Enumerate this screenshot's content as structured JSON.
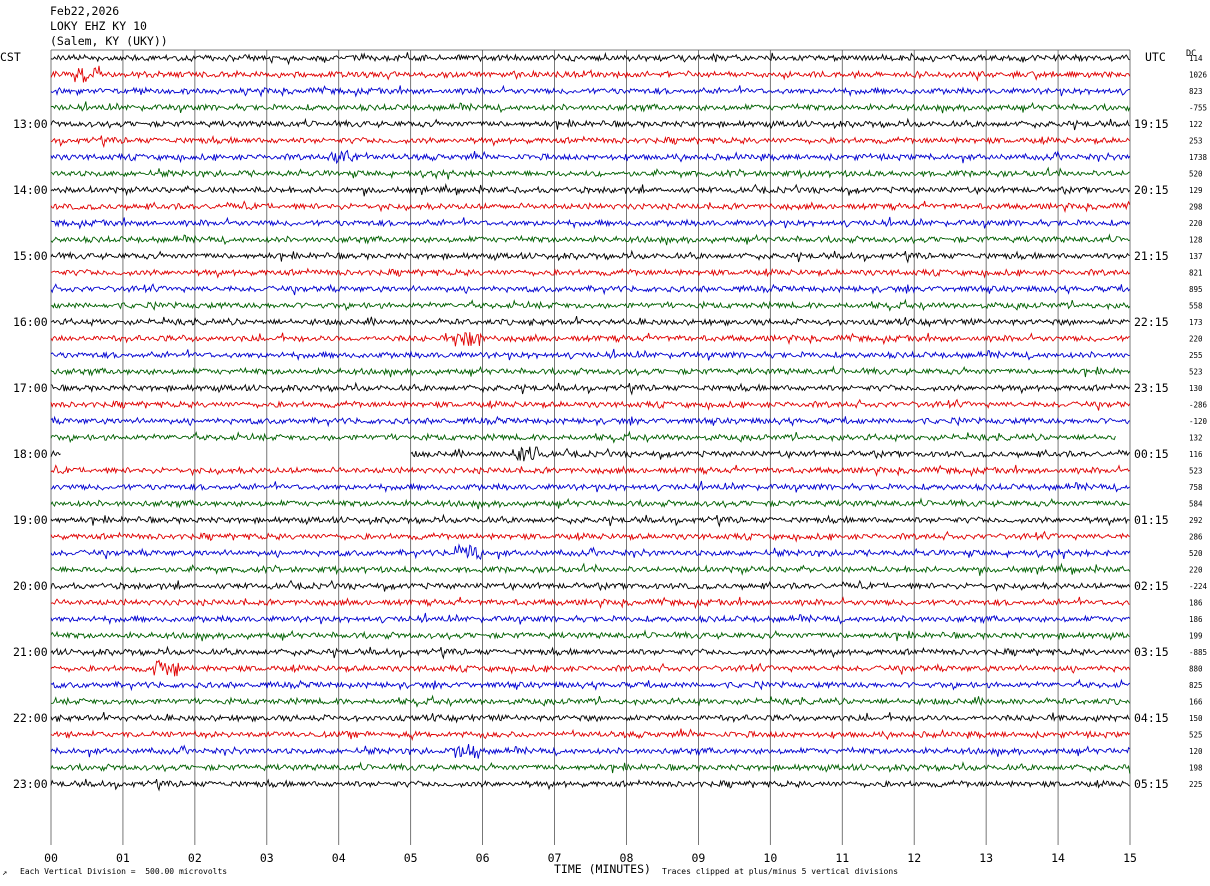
{
  "header": {
    "date": "Feb22,2026",
    "station": "LOKY EHZ KY 10",
    "location": "(Salem, KY (UKY))"
  },
  "left_zone": "CST",
  "right_zone": "UTC",
  "dc_label": "DC",
  "footer": {
    "scale": "Each Vertical Division =  500.00 microvolts",
    "axis_title": "TIME (MINUTES)",
    "clip_note": "Traces clipped at plus/minus 5 vertical divisions"
  },
  "chart_data": {
    "type": "line",
    "title": "LOKY EHZ KY 10",
    "xlabel": "TIME (MINUTES)",
    "ylabel": "",
    "x_ticks": [
      "00",
      "01",
      "02",
      "03",
      "04",
      "05",
      "06",
      "07",
      "08",
      "09",
      "10",
      "11",
      "12",
      "13",
      "14",
      "15"
    ],
    "xlim": [
      0,
      15
    ],
    "trace_colors": [
      "#000000",
      "#e00000",
      "#0000d0",
      "#006000"
    ],
    "left_hour_labels": [
      "13:00",
      "14:00",
      "15:00",
      "16:00",
      "17:00",
      "18:00",
      "19:00",
      "20:00",
      "21:00",
      "22:00",
      "23:00"
    ],
    "right_hour_labels": [
      "19:15",
      "20:15",
      "21:15",
      "22:15",
      "23:15",
      "00:15",
      "01:15",
      "02:15",
      "03:15",
      "04:15",
      "05:15"
    ],
    "dc_offsets": [
      "114",
      "1026",
      "823",
      "-755",
      "122",
      "253",
      "1738",
      "520",
      "129",
      "298",
      "220",
      "128",
      "137",
      "821",
      "895",
      "558",
      "173",
      "220",
      "255",
      "523",
      "130",
      "-286",
      "-120",
      "132",
      "116",
      "523",
      "758",
      "584",
      "292",
      "286",
      "520",
      "220",
      "-224",
      "186",
      "186",
      "199",
      "-885",
      "880",
      "825",
      "166",
      "150",
      "525",
      "120",
      "198",
      "225"
    ],
    "traces": 45,
    "trace_interval_minutes": 15,
    "events": [
      {
        "trace": 1,
        "minute": 0.5
      },
      {
        "trace": 6,
        "minute": 4.1
      },
      {
        "trace": 17,
        "minute": 5.8
      },
      {
        "trace": 24,
        "minute": 6.6
      },
      {
        "trace": 30,
        "minute": 5.8
      },
      {
        "trace": 37,
        "minute": 1.6
      },
      {
        "trace": 42,
        "minute": 5.8
      }
    ],
    "gaps": [
      {
        "trace": 23,
        "from_minute": 14.8,
        "to_minute": 15
      },
      {
        "trace": 24,
        "from_minute": 0.15,
        "to_minute": 5.0
      }
    ],
    "grid": true
  }
}
